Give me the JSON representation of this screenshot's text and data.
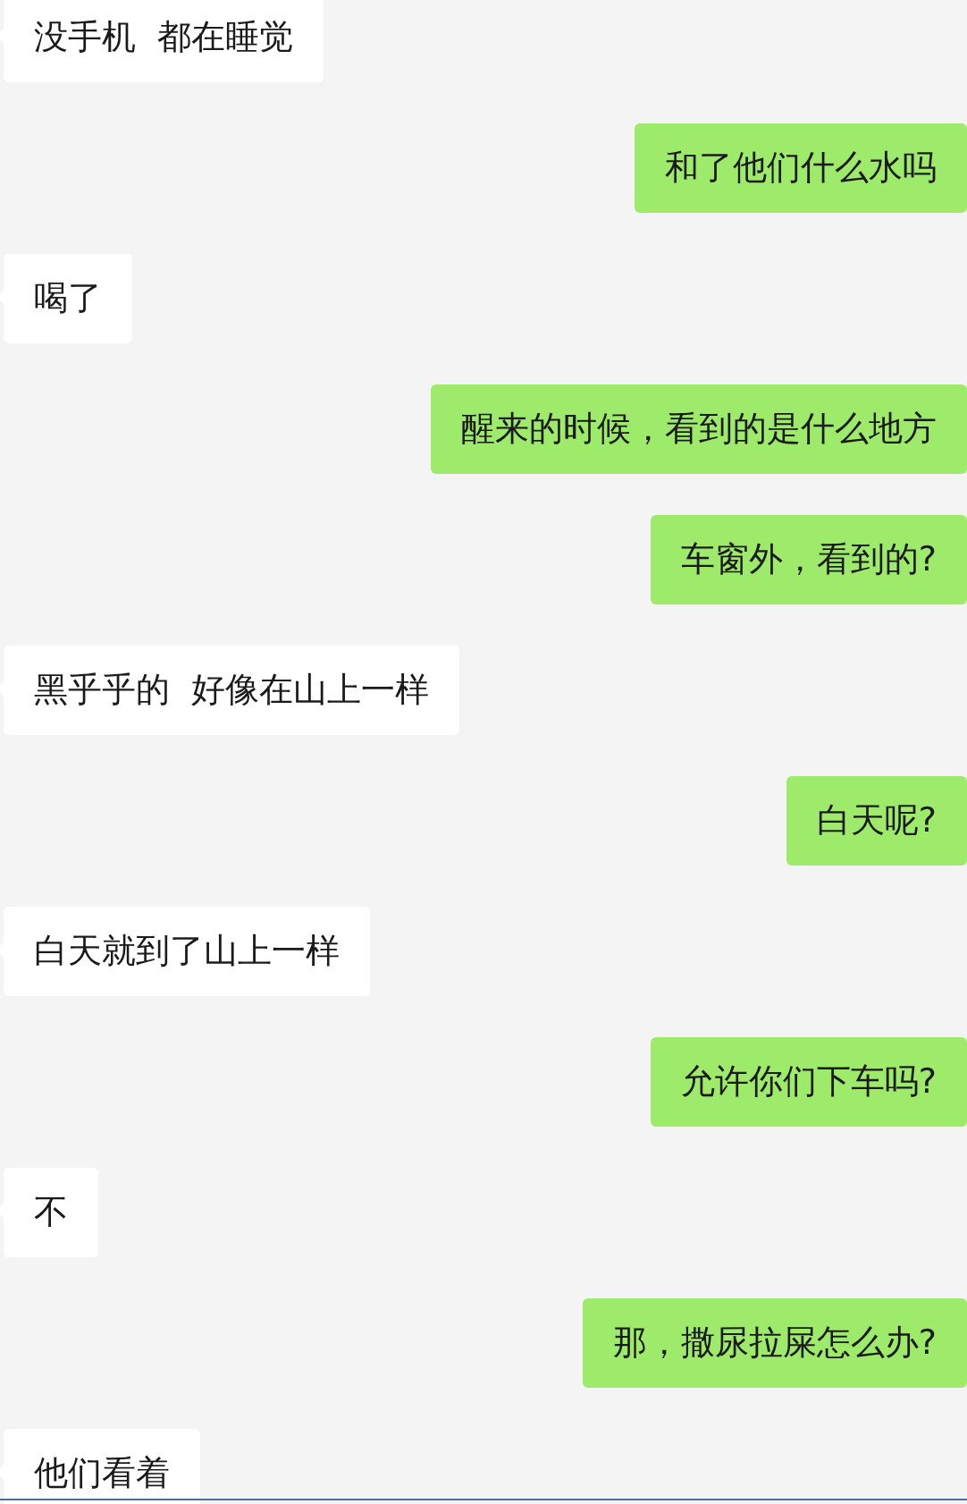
{
  "messages": [
    {
      "kind": "incoming",
      "text": "没手机  都在睡觉"
    },
    {
      "kind": "outgoing",
      "text": "和了他们什么水吗"
    },
    {
      "kind": "incoming",
      "text": "喝了"
    },
    {
      "kind": "outgoing",
      "text": "醒来的时候，看到的是什么地方"
    },
    {
      "kind": "outgoing",
      "text": "车窗外，看到的?"
    },
    {
      "kind": "incoming",
      "text": "黑乎乎的  好像在山上一样"
    },
    {
      "kind": "outgoing",
      "text": "白天呢?"
    },
    {
      "kind": "incoming",
      "text": "白天就到了山上一样"
    },
    {
      "kind": "outgoing",
      "text": "允许你们下车吗?"
    },
    {
      "kind": "incoming",
      "text": "不"
    },
    {
      "kind": "outgoing",
      "text": "那，撒尿拉屎怎么办?"
    },
    {
      "kind": "incoming",
      "text": "他们看着"
    }
  ]
}
